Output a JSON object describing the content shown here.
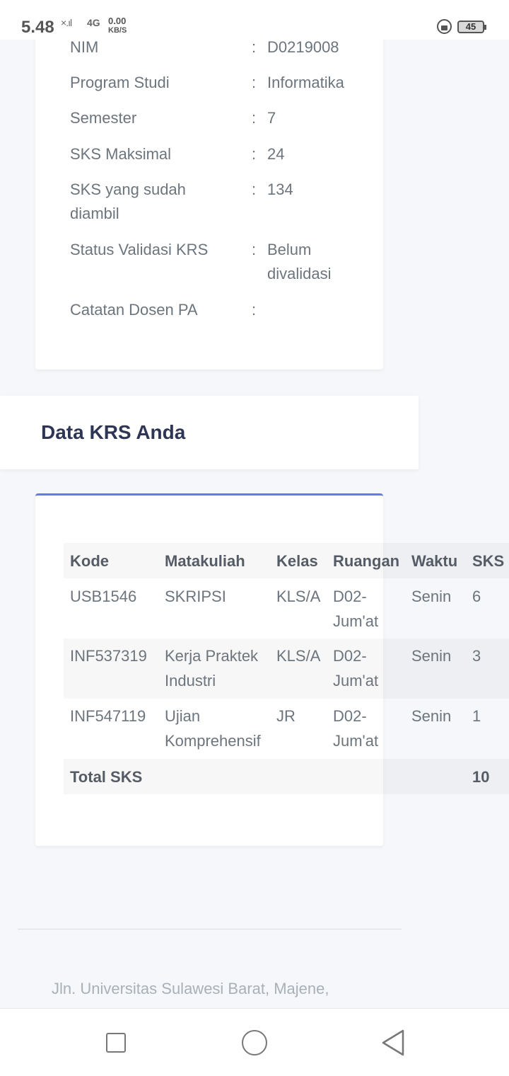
{
  "status_bar": {
    "time": "5.48",
    "signal": "×.ıl",
    "network": "4G",
    "speed_value": "0.00",
    "speed_unit": "KB/S",
    "battery": "45"
  },
  "profile": {
    "rows": [
      {
        "label": "NIM",
        "colon": ":",
        "value": "D0219008"
      },
      {
        "label": "Program Studi",
        "colon": ":",
        "value": "Informatika"
      },
      {
        "label": "Semester",
        "colon": ":",
        "value": "7"
      },
      {
        "label": "SKS Maksimal",
        "colon": ":",
        "value": "24"
      },
      {
        "label": "SKS yang sudah diambil",
        "colon": ":",
        "value": "134"
      },
      {
        "label": "Status Validasi KRS",
        "colon": ":",
        "value": "Belum divalidasi"
      },
      {
        "label": "Catatan Dosen PA",
        "colon": ":",
        "value": ""
      }
    ]
  },
  "section": {
    "title": "Data KRS Anda"
  },
  "krs_table": {
    "headers": [
      "Kode",
      "Matakuliah",
      "Kelas",
      "Ruangan",
      "Waktu",
      "SKS"
    ],
    "rows": [
      {
        "kode": "USB1546",
        "matakuliah": "SKRIPSI",
        "kelas": "KLS/A",
        "ruangan": "D02-Jum'at",
        "waktu": "Senin",
        "sks": "6"
      },
      {
        "kode": "INF537319",
        "matakuliah": "Kerja Praktek Industri",
        "kelas": "KLS/A",
        "ruangan": "D02-Jum'at",
        "waktu": "Senin",
        "sks": "3"
      },
      {
        "kode": "INF547119",
        "matakuliah": "Ujian Komprehensif",
        "kelas": "JR",
        "ruangan": "D02-Jum'at",
        "waktu": "Senin",
        "sks": "1"
      }
    ],
    "total_label": "Total SKS",
    "total_value": "10"
  },
  "footer": {
    "address": "Jln. Universitas Sulawesi Barat, Majene,"
  },
  "nav": {
    "icons": [
      "recent-apps-icon",
      "home-icon",
      "back-icon"
    ]
  },
  "colors": {
    "accent": "#6777ef",
    "title": "#2f3554",
    "text": "#6c757d"
  }
}
